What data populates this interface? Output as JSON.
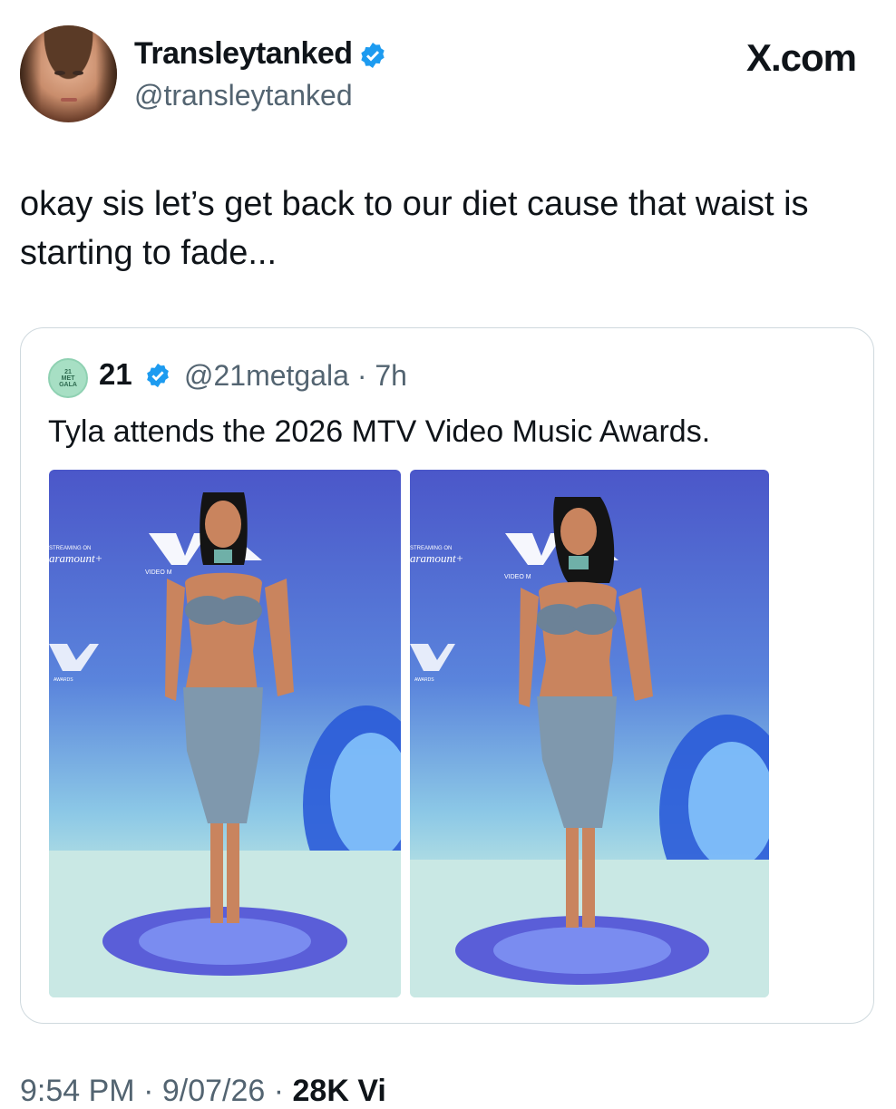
{
  "post": {
    "display_name": "Transleytanked",
    "handle": "@transleytanked",
    "site_label": "X.com",
    "text": "okay sis let’s get back to our diet cause that waist is starting to fade..."
  },
  "quote": {
    "avatar_text": "21\nMET\nGALA",
    "display_name": "21",
    "handle_time": "@21metgala · 7h",
    "text": "Tyla attends the 2026 MTV Video Music Awards.",
    "photos": [
      {
        "alt": "Tyla on VMA red carpet, front view"
      },
      {
        "alt": "Tyla on VMA red carpet, slight turn"
      }
    ],
    "backdrop_text": {
      "streaming_on": "STREAMING ON",
      "brand": "aramount+",
      "video": "VIDEO M",
      "awards": "AWARDS"
    }
  },
  "footer": {
    "time_date": "9:54 PM · 9/07/26 ·",
    "views": "28K Vi"
  },
  "colors": {
    "verified": "#1d9bf0",
    "muted_text": "#536471",
    "border": "#cfd9de"
  }
}
